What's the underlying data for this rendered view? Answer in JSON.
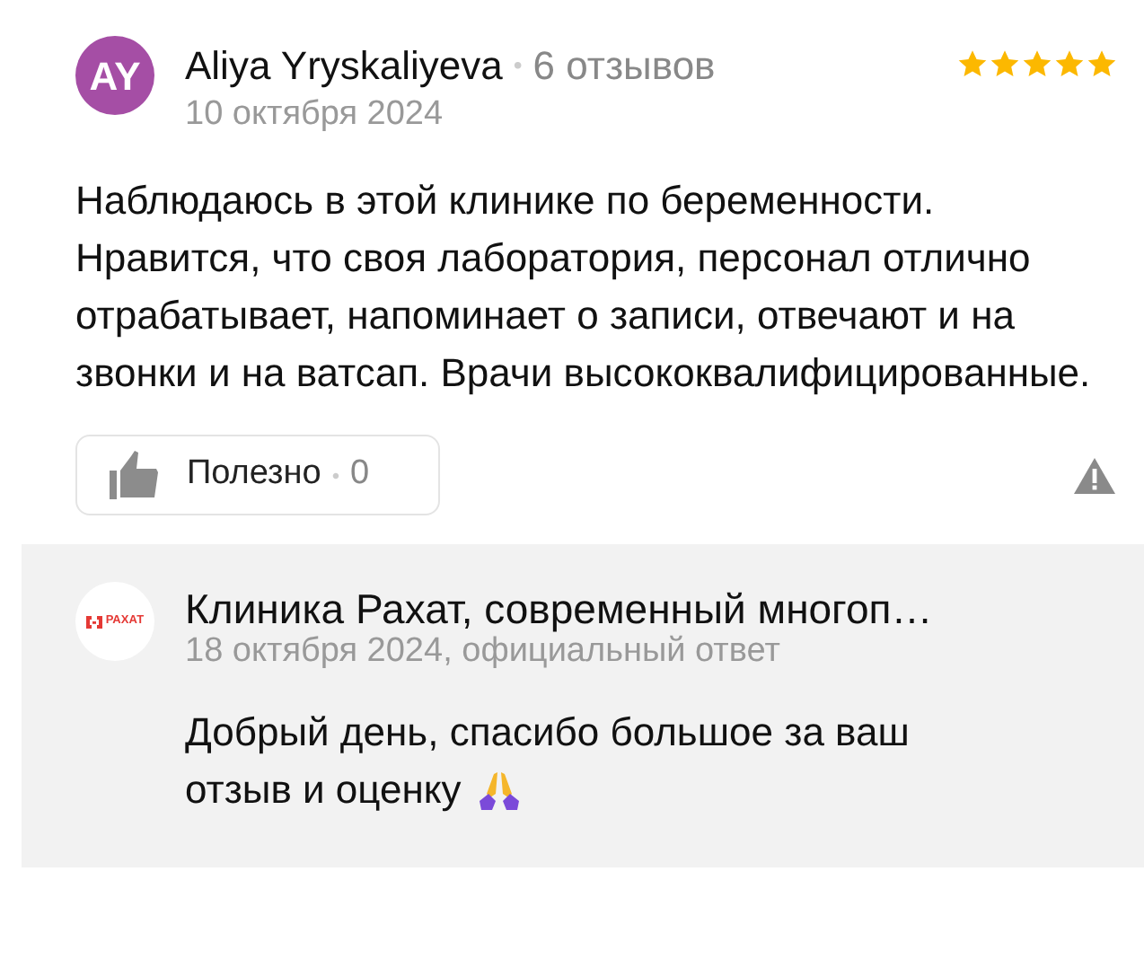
{
  "review": {
    "avatar_initials": "AY",
    "author": "Aliya Yryskaliyeva",
    "separator": "•",
    "reviews_count": "6 отзывов",
    "stars": 5,
    "date": "10 октября 2024",
    "text": "Наблюдаюсь в этой клинике по беременности. Нравится, что своя лаборатория, персонал отлично отрабатывает, напоминает о записи, отвечают и на звонки и на ватсап. Врачи высококвалифицированные.",
    "helpful": {
      "label": "Полезно",
      "separator": "•",
      "count": "0"
    }
  },
  "reply": {
    "logo_text": "РАХАТ",
    "author": "Клиника Рахат, современный многоп…",
    "meta": "18 октября 2024, официальный ответ",
    "text_lines": [
      "Добрый день, спасибо большое за ваш",
      "отзыв и оценку"
    ]
  }
}
